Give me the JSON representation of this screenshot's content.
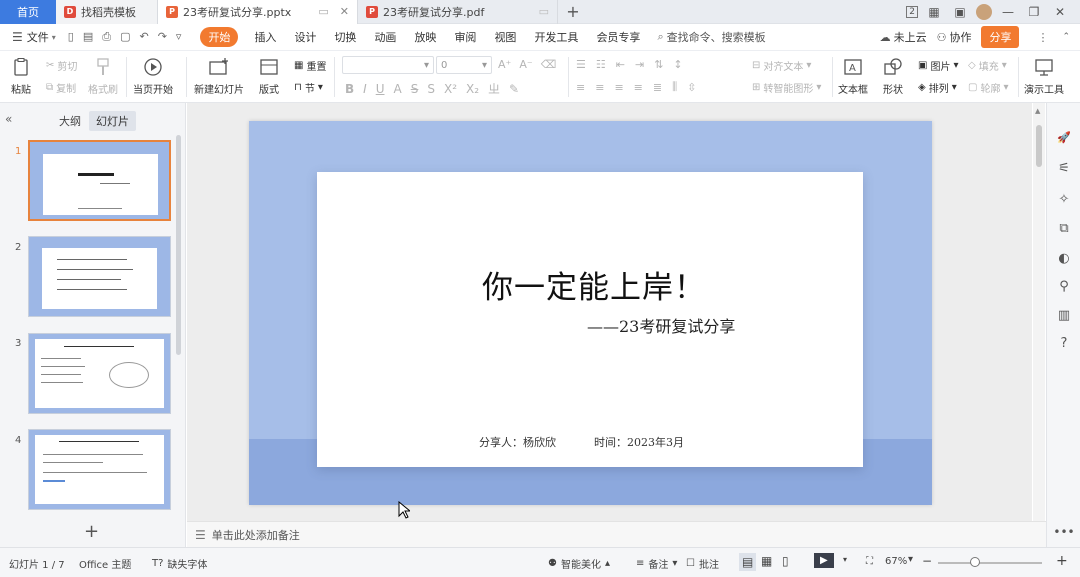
{
  "titlebar": {
    "home": "首页",
    "tabs": [
      {
        "label": "找稻壳模板",
        "logo": "D",
        "color": "#e04b3c"
      },
      {
        "label": "23考研复试分享.pptx",
        "logo": "P",
        "color": "#e8643a"
      },
      {
        "label": "23考研复试分享.pdf",
        "logo": "P",
        "color": "#e04b3c"
      }
    ],
    "badge": "2"
  },
  "menubar": {
    "file": "文件",
    "tabs": [
      "开始",
      "插入",
      "设计",
      "切换",
      "动画",
      "放映",
      "审阅",
      "视图",
      "开发工具",
      "会员专享"
    ],
    "search": "查找命令、搜索模板",
    "cloud": "未上云",
    "collab": "协作",
    "share": "分享"
  },
  "ribbon": {
    "paste": "粘贴",
    "cut": "剪切",
    "copy": "复制",
    "format_painter": "格式刷",
    "from_current": "当页开始",
    "new_slide": "新建幻灯片",
    "layout": "版式",
    "section": "节",
    "reset": "重置",
    "font_size": "0",
    "align_text": "对齐文本",
    "smart_shape": "转智能图形",
    "textbox": "文本框",
    "shape": "形状",
    "arrange": "排列",
    "picture": "图片",
    "fill": "填充",
    "outline": "轮廓",
    "present_tools": "演示工具"
  },
  "leftpanel": {
    "outline_tab": "大纲",
    "slides_tab": "幻灯片",
    "numbers": [
      "1",
      "2",
      "3",
      "4"
    ]
  },
  "slide": {
    "title": "你一定能上岸！",
    "subtitle": "——23考研复试分享",
    "presenter": "分享人：杨欣欣",
    "time": "时间：2023年3月"
  },
  "notes": {
    "placeholder": "单击此处添加备注"
  },
  "statusbar": {
    "slide_index": "幻灯片 1 / 7",
    "theme": "Office 主题",
    "missing_font": "缺失字体",
    "beautify": "智能美化",
    "notes": "备注",
    "comments": "批注",
    "zoom": "67%"
  }
}
